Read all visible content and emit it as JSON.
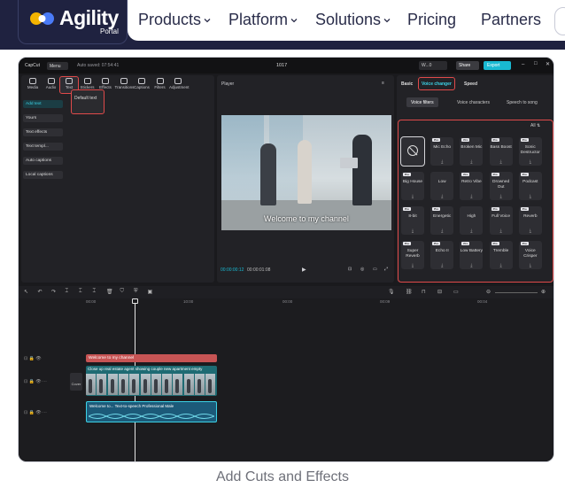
{
  "site": {
    "brand_name": "Agility",
    "brand_sub": "Portal",
    "nav": [
      "Products",
      "Platform",
      "Solutions",
      "Pricing",
      "Partners"
    ],
    "nav_has_dropdown": [
      true,
      true,
      true,
      false,
      false
    ],
    "caption": "Add Cuts and Effects",
    "colors": {
      "navy": "#1f2240",
      "highlight": "#e04a4a",
      "accent": "#19b9d2"
    }
  },
  "app": {
    "logo": "CapCut",
    "menu_label": "Menu",
    "autosave": "Auto saved: 07:54:41",
    "project_name": "1017",
    "user_label": "W...0",
    "share_label": "Share",
    "export_label": "Export",
    "tools": [
      "Media",
      "Audio",
      "Text",
      "Stickers",
      "Effects",
      "Transitions",
      "Captions",
      "Filters",
      "Adjustment"
    ],
    "text_sidebar": [
      "Add text",
      "Yours",
      "Text effects",
      "Text templ...",
      "Auto captions",
      "Local captions"
    ],
    "default_text": "Default text",
    "player_label": "Player",
    "video_caption": "Welcome to my channel",
    "timecode_current": "00:00:00:12",
    "timecode_total": "00:00:01:08",
    "right_tabs": [
      "Basic",
      "Voice changer",
      "Speed"
    ],
    "sub_tabs": [
      "Voice filters",
      "Voice characters",
      "Speech to song"
    ],
    "all_filter": "All",
    "voice_filters": [
      {
        "name": "",
        "pro": false,
        "none": true
      },
      {
        "name": "Mic Echo",
        "pro": true
      },
      {
        "name": "Broken Mic",
        "pro": true
      },
      {
        "name": "Bass Boost",
        "pro": true
      },
      {
        "name": "Sonic Destructor",
        "pro": true
      },
      {
        "name": "Big House",
        "pro": true
      },
      {
        "name": "Low",
        "pro": false
      },
      {
        "name": "Retro Vibe",
        "pro": true
      },
      {
        "name": "Drowned Out",
        "pro": true
      },
      {
        "name": "Podcast",
        "pro": true
      },
      {
        "name": "8-bit",
        "pro": true
      },
      {
        "name": "Energetic",
        "pro": true
      },
      {
        "name": "High",
        "pro": false
      },
      {
        "name": "Full Voice",
        "pro": true
      },
      {
        "name": "Reverb",
        "pro": true
      },
      {
        "name": "Super Reverb",
        "pro": true
      },
      {
        "name": "Echo II",
        "pro": true
      },
      {
        "name": "Low Battery",
        "pro": true
      },
      {
        "name": "Tremble",
        "pro": true
      },
      {
        "name": "Voice Crisper",
        "pro": true
      }
    ],
    "ruler": [
      "00:00",
      "10:00",
      "00:00",
      "00:09",
      "00:04"
    ],
    "clip_text": "Welcome to my channel",
    "clip_video": "Close up real estate agent showing couple new apartment empty",
    "clip_audio": "Welcome to...  Text-to-speech Professional Male",
    "cover_label": "Cover"
  }
}
